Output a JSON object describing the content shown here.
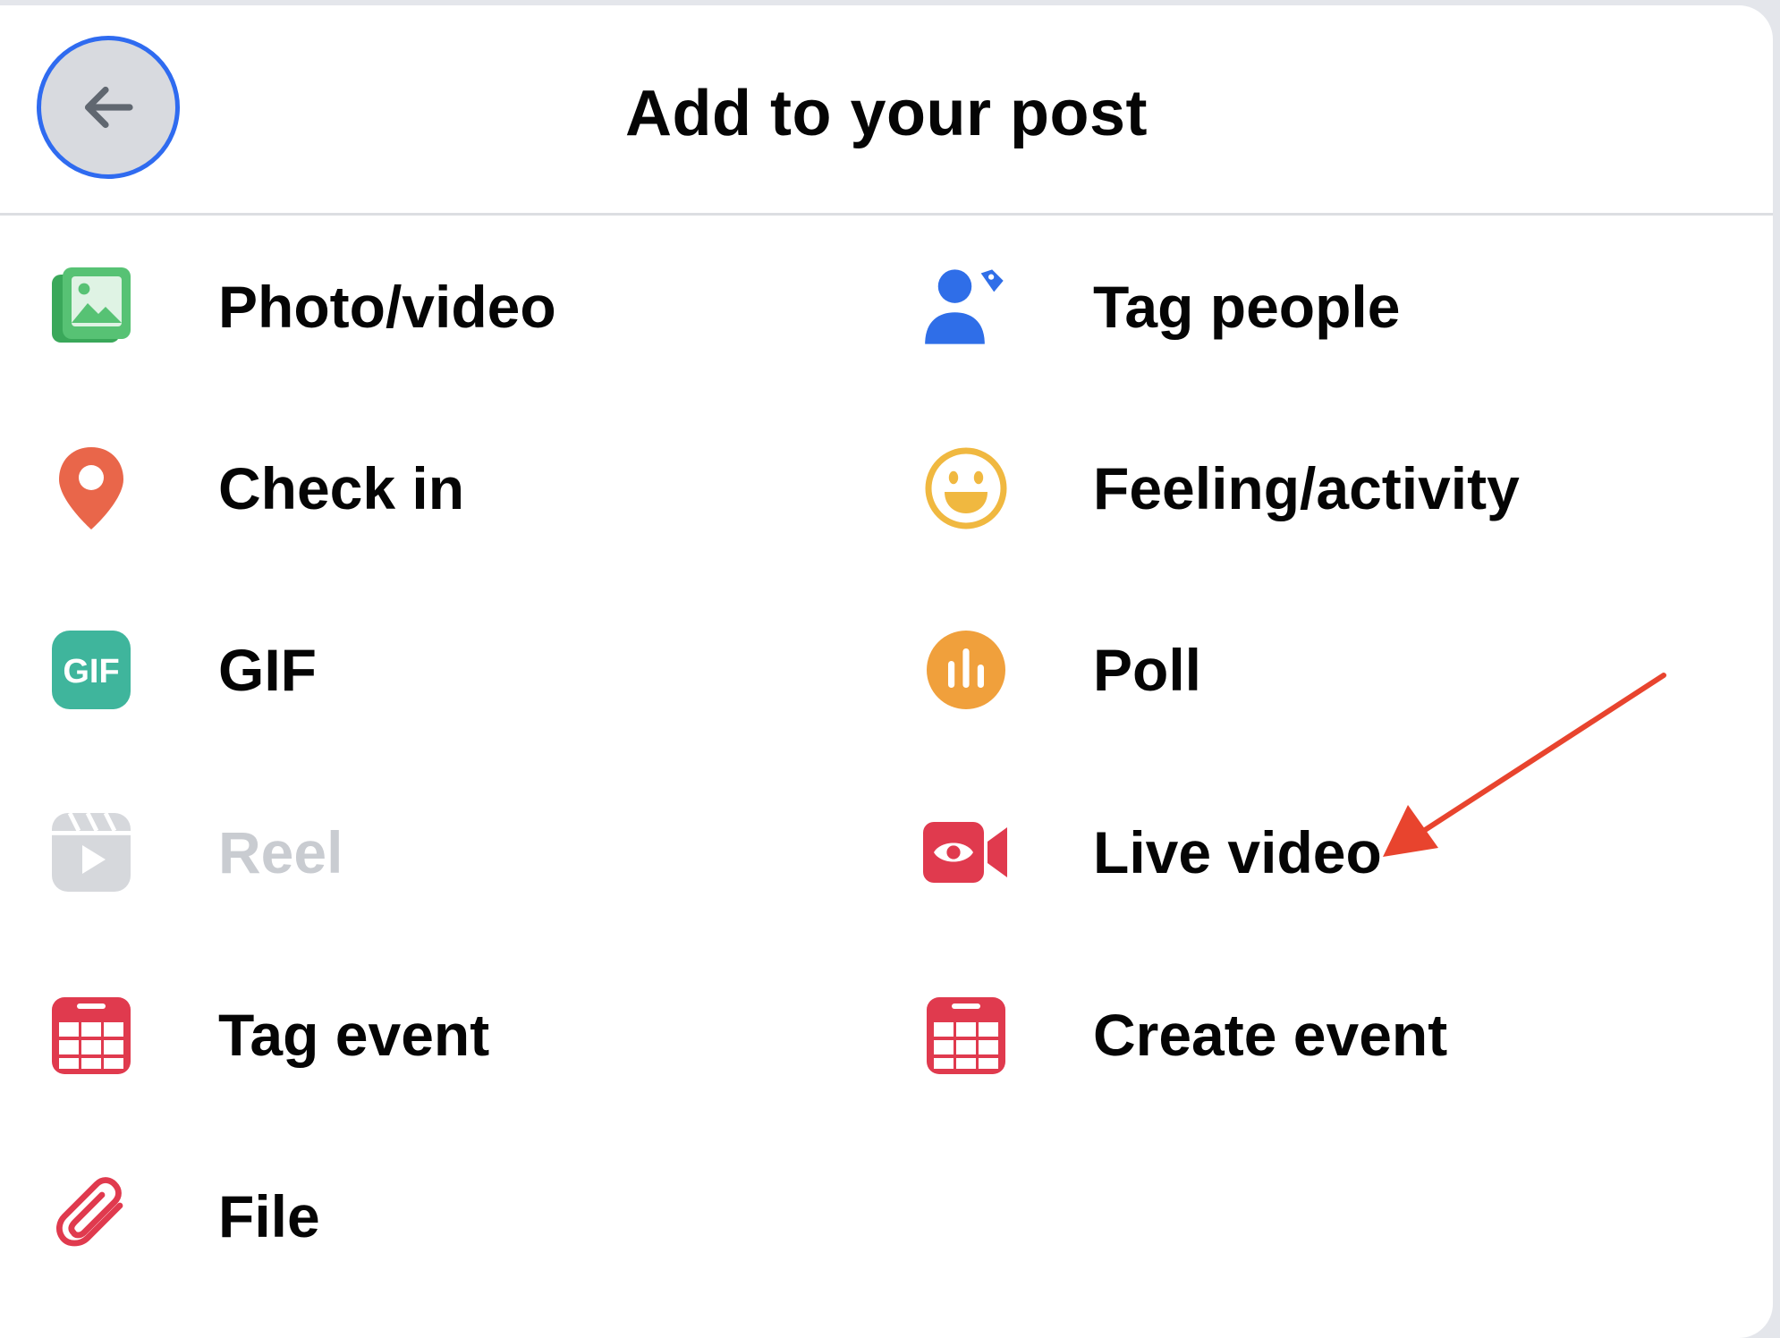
{
  "dialog": {
    "title": "Add to your post",
    "back_icon": "arrow-left-icon"
  },
  "options": {
    "photo_video": {
      "label": "Photo/video",
      "icon": "photo-icon",
      "color": "#45bd62"
    },
    "tag_people": {
      "label": "Tag people",
      "icon": "tag-people-icon",
      "color": "#2f6ee8"
    },
    "check_in": {
      "label": "Check in",
      "icon": "location-pin-icon",
      "color": "#e9664a"
    },
    "feeling": {
      "label": "Feeling/activity",
      "icon": "smiley-icon",
      "color": "#f0b840"
    },
    "gif": {
      "label": "GIF",
      "icon": "gif-icon",
      "color": "#3fb59c"
    },
    "poll": {
      "label": "Poll",
      "icon": "poll-icon",
      "color": "#f0a03c"
    },
    "reel": {
      "label": "Reel",
      "icon": "reel-icon",
      "color": "#d3d5d9",
      "disabled": true
    },
    "live_video": {
      "label": "Live video",
      "icon": "live-video-icon",
      "color": "#e03a4e"
    },
    "tag_event": {
      "label": "Tag event",
      "icon": "calendar-icon",
      "color": "#e03a4e"
    },
    "create_event": {
      "label": "Create event",
      "icon": "calendar-icon",
      "color": "#e03a4e"
    },
    "file": {
      "label": "File",
      "icon": "paperclip-icon",
      "color": "#e03a4e"
    }
  },
  "annotation": {
    "type": "arrow",
    "color": "#e8442e",
    "points_to": "Live video"
  }
}
